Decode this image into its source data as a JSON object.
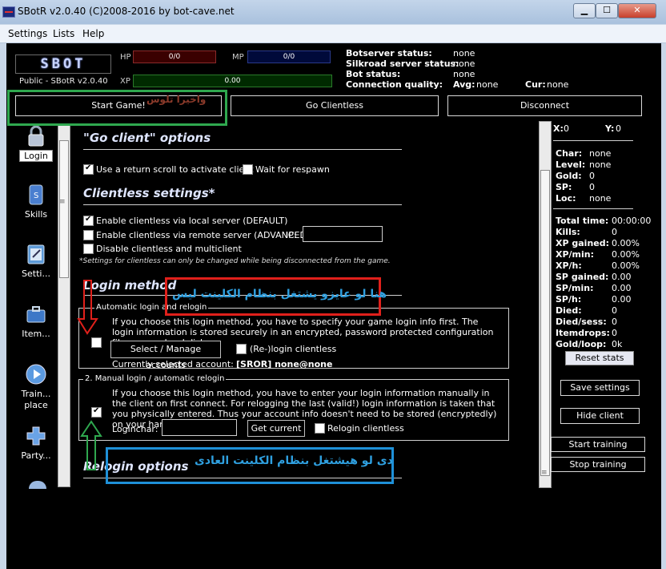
{
  "window": {
    "title": "SBotR v2.0.40 (C)2008-2016 by bot-cave.net"
  },
  "menu": [
    "Settings",
    "Lists",
    "Help"
  ],
  "header": {
    "logo": "SBOT",
    "version": "Public - SBotR v2.0.40",
    "hp_label": "HP",
    "hp_value": "0/0",
    "mp_label": "MP",
    "mp_value": "0/0",
    "xp_label": "XP",
    "xp_value": "0.00",
    "status": {
      "botserver_label": "Botserver status:",
      "botserver_value": "none",
      "silkroad_label": "Silkroad server status:",
      "silkroad_value": "none",
      "bot_label": "Bot status:",
      "bot_value": "none",
      "quality_label": "Connection quality:",
      "avg_label": "Avg:",
      "avg_value": "none",
      "cur_label": "Cur:",
      "cur_value": "none"
    }
  },
  "actions": {
    "start_game": "Start Game!",
    "go_clientless": "Go Clientless",
    "disconnect": "Disconnect"
  },
  "sidebar": [
    {
      "label": "Login",
      "icon": "lock-icon",
      "active": true
    },
    {
      "label": "Skills",
      "icon": "scroll-icon"
    },
    {
      "label": "Setti...",
      "icon": "notepad-icon"
    },
    {
      "label": "Item...",
      "icon": "briefcase-icon"
    },
    {
      "label": "Train... place",
      "icon": "play-icon"
    },
    {
      "label": "Party...",
      "icon": "plus-icon"
    }
  ],
  "go_client": {
    "heading": "\"Go client\" options",
    "return_scroll": {
      "label": "Use a return scroll to activate client",
      "checked": true
    },
    "wait_respawn": {
      "label": "Wait for respawn",
      "checked": false
    }
  },
  "clientless": {
    "heading": "Clientless settings*",
    "local": {
      "label": "Enable clientless via local server (DEFAULT)",
      "checked": true
    },
    "remote": {
      "label": "Enable clientless via remote server (ADVANCED)",
      "checked": false
    },
    "ip_label": "IP:",
    "ip_value": "",
    "disable": {
      "label": "Disable clientless and multiclient",
      "checked": false
    },
    "note": "*Settings for clientless can only be changed while being disconnected from the game."
  },
  "login_method": {
    "heading": "Login method",
    "auto": {
      "title": "Automatic login and relogin",
      "desc": "If you choose this login method, you have to specify your game login info first. The login information is stored securely in an encrypted, password protected configuration file on your hard disk.",
      "checked": false,
      "manage_btn": "Select / Manage accounts",
      "relogin_clientless": "(Re-)login clientless",
      "selected_label": "Currently selected account:",
      "selected_value": "[SROR] none@none"
    },
    "manual": {
      "title": "2. Manual login / automatic relogin",
      "desc": "If you choose this login method, you have to enter your login information manually in the client on first connect. For relogging the last (valid!) login information is taken that you physically entered. Thus your account info doesn't need to be stored (encryptedly) on your harddisk.",
      "checked": true,
      "loginchar_label": "Loginchar:",
      "loginchar_value": "",
      "get_current": "Get current",
      "relogin_clientless": "Relogin clientless"
    }
  },
  "relogin": {
    "heading": "Relogin options"
  },
  "stats": {
    "x_label": "X:",
    "x_value": "0",
    "y_label": "Y:",
    "y_value": "0",
    "char": [
      "Char:",
      "none"
    ],
    "level": [
      "Level:",
      "none"
    ],
    "gold": [
      "Gold:",
      "0"
    ],
    "sp": [
      "SP:",
      "0"
    ],
    "loc": [
      "Loc:",
      "none"
    ],
    "rows": [
      [
        "Total time:",
        "00:00:00"
      ],
      [
        "Kills:",
        "0"
      ],
      [
        "XP gained:",
        "0.00%"
      ],
      [
        "XP/min:",
        "0.00%"
      ],
      [
        "XP/h:",
        "0.00%"
      ],
      [
        "SP gained:",
        "0.00"
      ],
      [
        "SP/min:",
        "0.00"
      ],
      [
        "SP/h:",
        "0.00"
      ],
      [
        "Died:",
        "0"
      ],
      [
        "Died/sess:",
        "0"
      ],
      [
        "Itemdrops:",
        "0"
      ],
      [
        "Gold/loop:",
        "0k"
      ]
    ],
    "reset": "Reset stats"
  },
  "right_buttons": {
    "save": "Save settings",
    "hide": "Hide client",
    "start": "Start training",
    "stop": "Stop training"
  },
  "annotations": {
    "top": "واخيرا تلوس",
    "red": "هنا لو عايزو يشتغل بنظام الكلينت ليس",
    "blue": "دى لو هيشتغل بنظام الكلينت العادى",
    "colors": {
      "green": "#2fa84f",
      "red": "#e0201b",
      "blue": "#1e90d8"
    }
  }
}
